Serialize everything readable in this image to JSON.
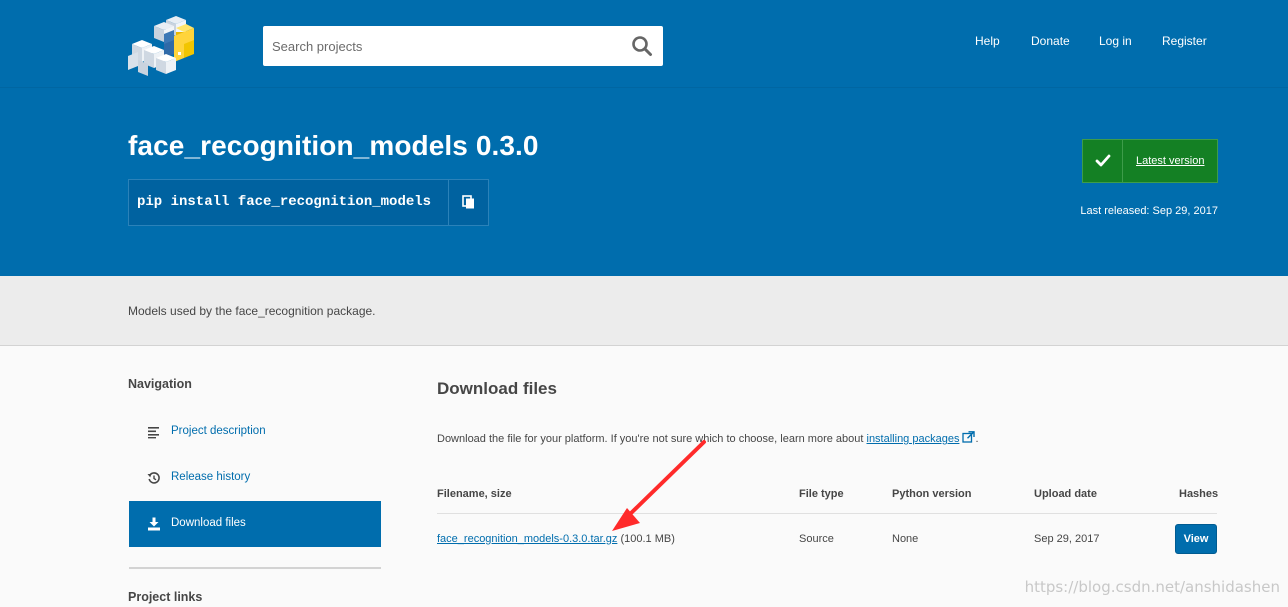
{
  "header": {
    "logo_icon": "pypi-cubes-logo-icon",
    "search": {
      "placeholder": "Search projects",
      "value": ""
    },
    "nav": [
      "Help",
      "Donate",
      "Log in",
      "Register"
    ]
  },
  "hero": {
    "title": "face_recognition_models 0.3.0",
    "pip_command": "pip install face_recognition_models",
    "copy_icon": "copy-icon",
    "latest_label": "Latest version",
    "released": "Last released: Sep 29, 2017"
  },
  "summary": "Models used by the face_recognition package.",
  "sidebar": {
    "navigation_heading": "Navigation",
    "items": [
      {
        "label": "Project description",
        "icon": "align-left-icon",
        "active": false
      },
      {
        "label": "Release history",
        "icon": "history-icon",
        "active": false
      },
      {
        "label": "Download files",
        "icon": "download-icon",
        "active": true
      }
    ],
    "links_heading": "Project links"
  },
  "main": {
    "title": "Download files",
    "intro_text": "Download the file for your platform. If you're not sure which to choose, learn more about ",
    "intro_link": "installing packages",
    "intro_end": ".",
    "table": {
      "headers": [
        "Filename, size",
        "File type",
        "Python version",
        "Upload date",
        "Hashes"
      ],
      "rows": [
        {
          "filename": "face_recognition_models-0.3.0.tar.gz",
          "size": "(100.1 MB)",
          "file_type": "Source",
          "python_version": "None",
          "upload_date": "Sep 29, 2017",
          "hashes_button": "View"
        }
      ]
    }
  },
  "annotation": {
    "arrow_color": "#ff2a2a"
  },
  "watermark": "https://blog.csdn.net/anshidashen",
  "colors": {
    "brand_blue": "#006dad",
    "success_green": "#148024"
  }
}
